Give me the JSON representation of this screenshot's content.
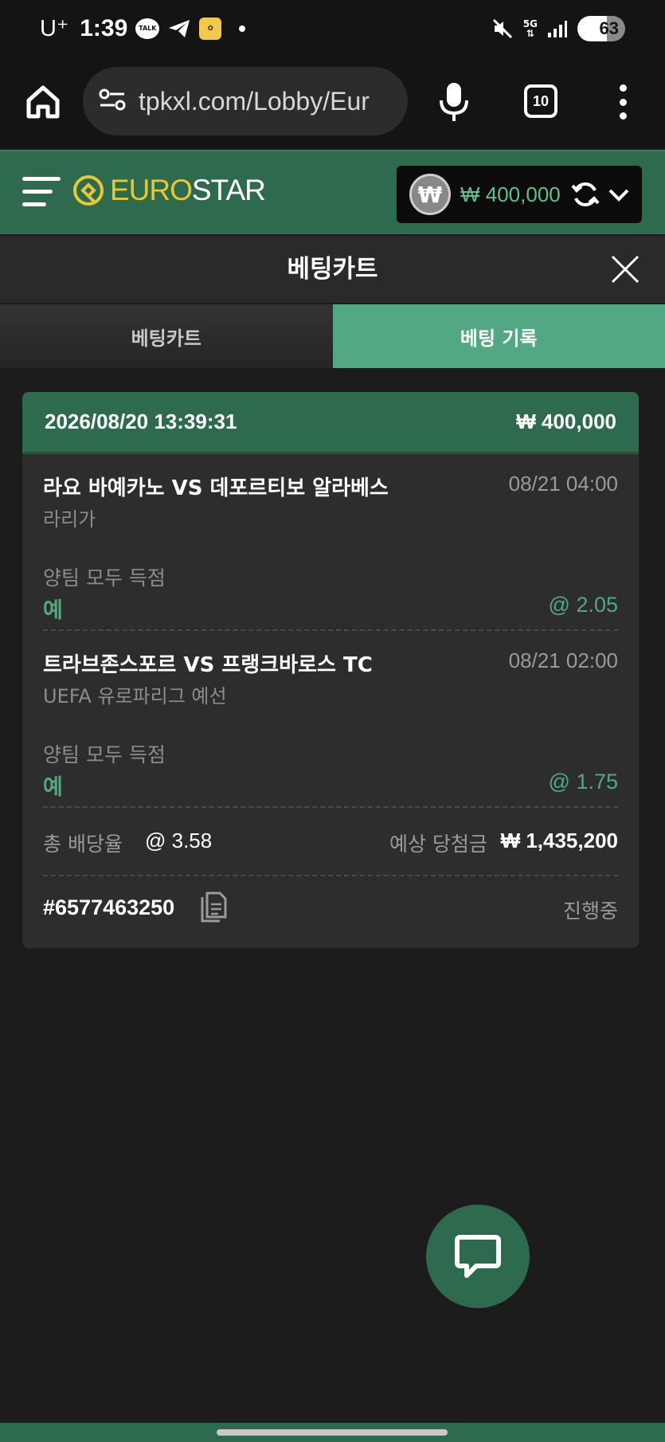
{
  "status_bar": {
    "carrier": "U⁺",
    "time": "1:39",
    "talk_label": "TALK",
    "network": "5G",
    "battery": "63"
  },
  "browser": {
    "url": "tpkxl.com/Lobby/Eur",
    "tab_count": "10"
  },
  "site": {
    "logo_euro": "EURO",
    "logo_star": "STAR",
    "currency_symbol": "₩",
    "balance": "₩ 400,000"
  },
  "cart": {
    "title": "베팅카트",
    "tabs": [
      {
        "label": "베팅카트",
        "active": false
      },
      {
        "label": "베팅 기록",
        "active": true
      }
    ]
  },
  "bet": {
    "datetime": "2026/08/20 13:39:31",
    "stake": "₩ 400,000",
    "selections": [
      {
        "match": "라요 바예카노 VS 데포르티보 알라베스",
        "kickoff": "08/21 04:00",
        "league": "라리가",
        "market": "양팀 모두 득점",
        "pick": "예",
        "odds": "@ 2.05"
      },
      {
        "match": "트라브존스포르 VS 프랭크바로스 TC",
        "kickoff": "08/21 02:00",
        "league": "UEFA 유로파리그 예선",
        "market": "양팀 모두 득점",
        "pick": "예",
        "odds": "@ 1.75"
      }
    ],
    "total_odds_label": "총 배당율",
    "total_odds": "@ 3.58",
    "expected_win_label": "예상 당첨금",
    "expected_win": "₩ 1,435,200",
    "ticket_id": "#6577463250",
    "status": "진행중"
  },
  "colors": {
    "brand_green": "#2e6a4e",
    "accent_green": "#52a882",
    "logo_yellow": "#e8c832"
  }
}
